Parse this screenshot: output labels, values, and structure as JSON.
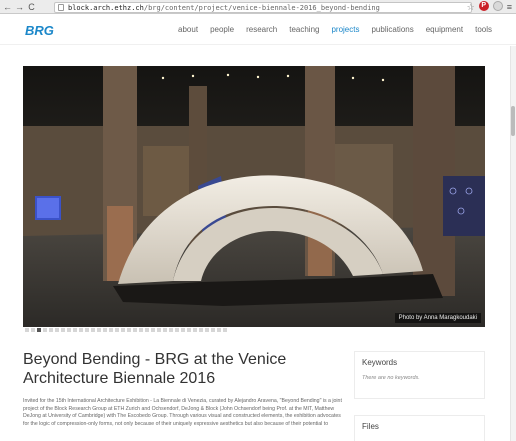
{
  "browser": {
    "url_host": "block.arch.ethz.ch",
    "url_path": "/brg/content/project/venice-biennale-2016_beyond-bending",
    "back_glyph": "←",
    "forward_glyph": "→",
    "reload_glyph": "C",
    "star_glyph": "☆",
    "pinterest_glyph": "P",
    "menu_glyph": "≡"
  },
  "site": {
    "logo": "BRG",
    "nav": [
      {
        "label": "about",
        "active": false
      },
      {
        "label": "people",
        "active": false
      },
      {
        "label": "research",
        "active": false
      },
      {
        "label": "teaching",
        "active": false
      },
      {
        "label": "projects",
        "active": true
      },
      {
        "label": "publications",
        "active": false
      },
      {
        "label": "equipment",
        "active": false
      },
      {
        "label": "tools",
        "active": false
      }
    ]
  },
  "hero": {
    "credit": "Photo by Anna Maragkoudaki",
    "slide_count": 34,
    "active_slide": 2
  },
  "article": {
    "title": "Beyond Bending - BRG at the Venice Architecture Biennale 2016",
    "body": "Invited for the 15th International Architecture Exhibition - La Biennale di Venezia, curated by Alejandro Aravena, \"Beyond Bending\" is a joint project of the Block Research Group at ETH Zurich and Ochsendorf, DeJong & Block (John Ochsendorf being Prof. at the MIT, Matthew DeJong at University of Cambridge) with The Escobedo Group. Through various visual and constructed elements, the exhibition advocates for the logic of compression-only forms, not only because of their uniquely expressive aesthetics but also because of their potential to"
  },
  "sidebar": {
    "keywords_title": "Keywords",
    "keywords_empty": "There are no keywords.",
    "files_title": "Files"
  },
  "colors": {
    "brand": "#1b87c9",
    "text": "#333333",
    "muted": "#666666"
  }
}
